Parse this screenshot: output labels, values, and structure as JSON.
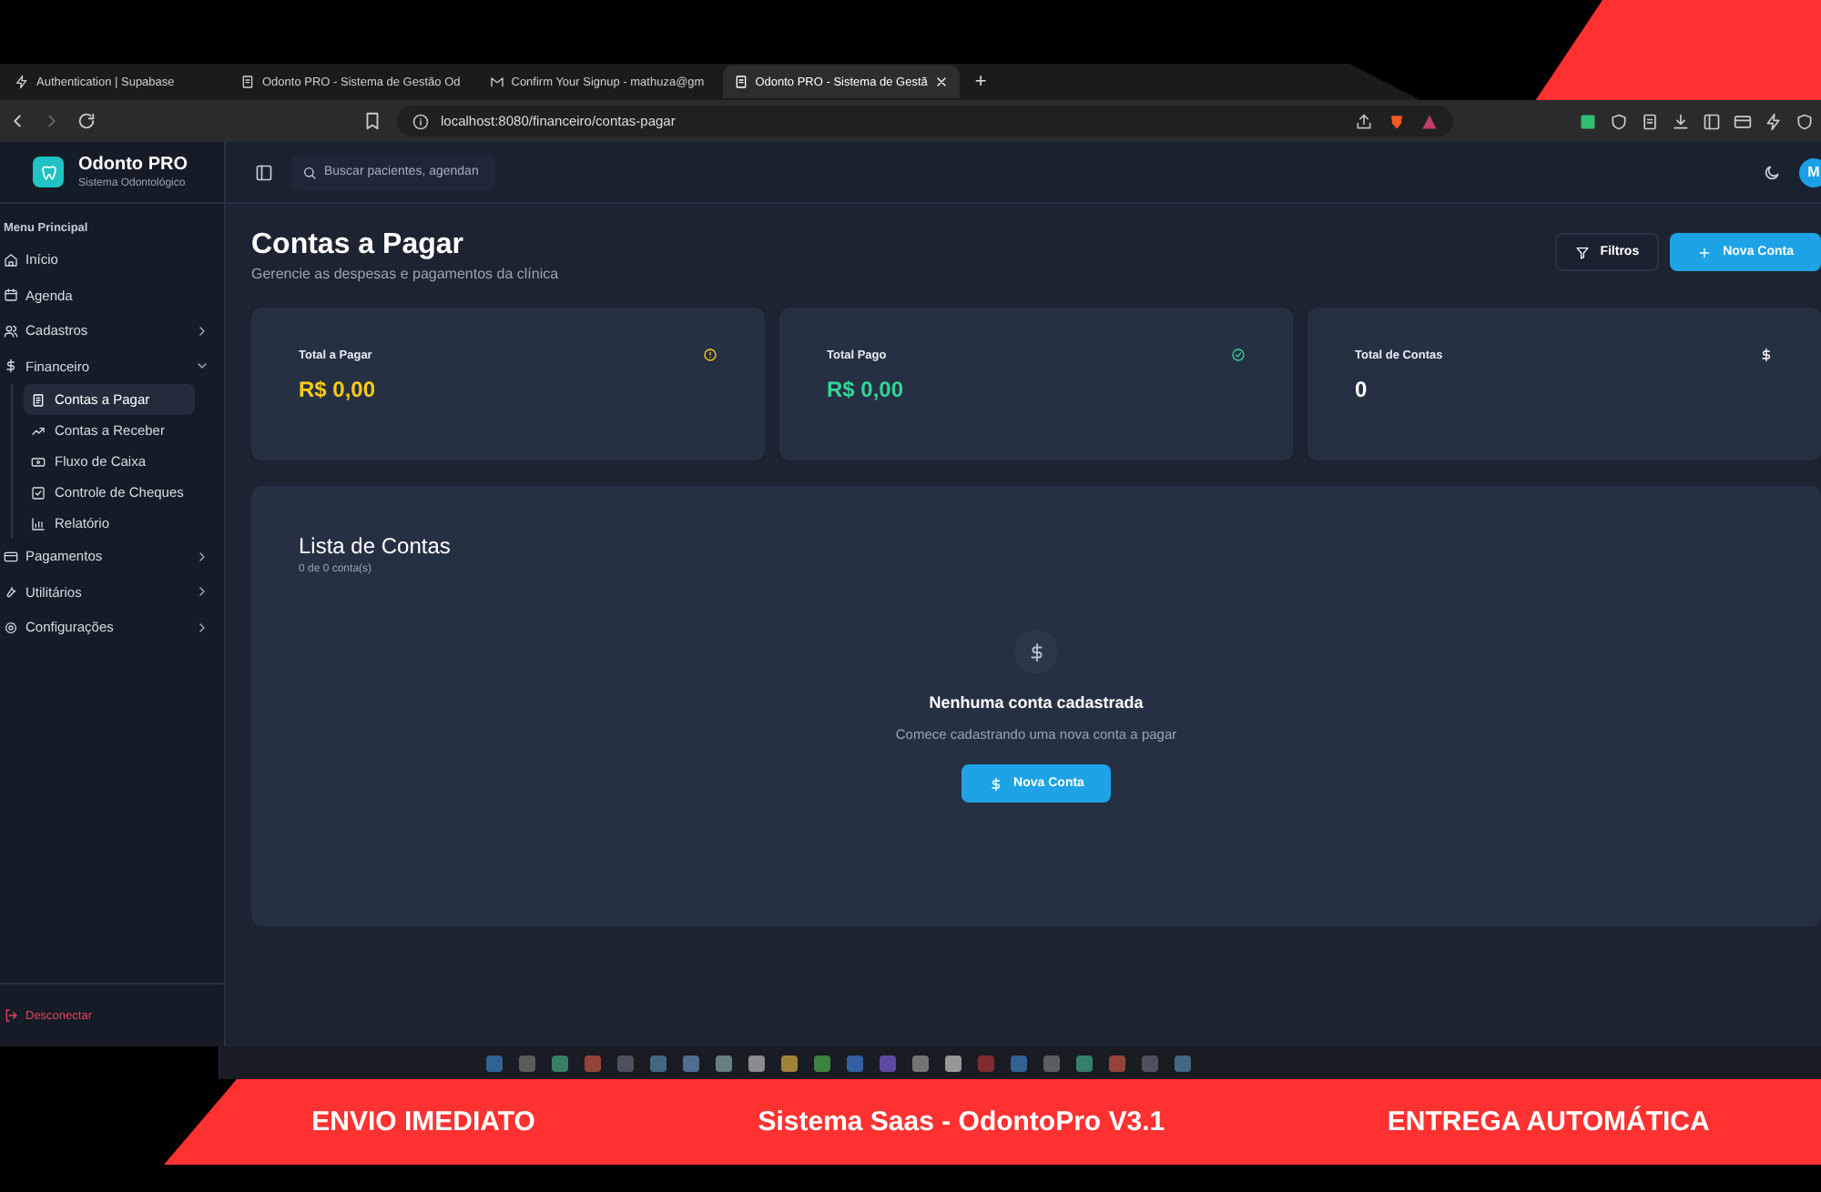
{
  "browser": {
    "tabs": [
      {
        "label": "Authentication | Supabase",
        "selected": false
      },
      {
        "label": "Odonto PRO - Sistema de Gestão Od",
        "selected": false
      },
      {
        "label": "Confirm Your Signup - mathuza@gm",
        "selected": false
      },
      {
        "label": "Odonto PRO - Sistema de Gestã",
        "selected": true
      }
    ],
    "new_tab": "+",
    "address": "localhost:8080/financeiro/contas-pagar"
  },
  "sidebar": {
    "brand": "Odonto PRO",
    "tagline": "Sistema Odontológico",
    "section": "Menu Principal",
    "items": [
      {
        "label": "Início",
        "kind": "link"
      },
      {
        "label": "Agenda",
        "kind": "link"
      },
      {
        "label": "Cadastros",
        "kind": "group",
        "expanded": false
      },
      {
        "label": "Financeiro",
        "kind": "group",
        "expanded": true,
        "children": [
          {
            "label": "Contas a Pagar",
            "selected": true
          },
          {
            "label": "Contas a Receber",
            "selected": false
          },
          {
            "label": "Fluxo de Caixa",
            "selected": false
          },
          {
            "label": "Controle de Cheques",
            "selected": false
          },
          {
            "label": "Relatório",
            "selected": false
          }
        ]
      },
      {
        "label": "Pagamentos",
        "kind": "group",
        "expanded": false
      },
      {
        "label": "Utilitários",
        "kind": "group",
        "expanded": false
      },
      {
        "label": "Configurações",
        "kind": "group",
        "expanded": false
      }
    ],
    "logout": "Desconectar"
  },
  "header": {
    "search": {
      "placeholder": "Buscar pacientes, agendan"
    },
    "avatar": "M"
  },
  "page": {
    "title": "Contas a Pagar",
    "subtitle": "Gerencie as despesas e pagamentos da clínica",
    "buttons": [
      {
        "label": "Filtros",
        "kind": "outline"
      },
      {
        "label": "Nova Conta",
        "kind": "primary"
      }
    ]
  },
  "stats": [
    {
      "label": "Total a Pagar",
      "value": "R$ 0,00",
      "color": "#facc15"
    },
    {
      "label": "Total Pago",
      "value": "R$ 0,00",
      "color": "#34d399"
    },
    {
      "label": "Total de Contas",
      "value": "0",
      "color": "#ffffff"
    }
  ],
  "list": {
    "title": "Lista de Contas",
    "count": "0 de 0 conta(s)",
    "empty_title": "Nenhuma conta cadastrada",
    "empty_text": "Comece cadastrando uma nova conta a pagar",
    "button": "Nova Conta"
  },
  "banner": [
    "ENVIO IMEDIATO",
    "Sistema Saas - OdontoPro V3.1",
    "ENTREGA AUTOMÁTICA"
  ]
}
